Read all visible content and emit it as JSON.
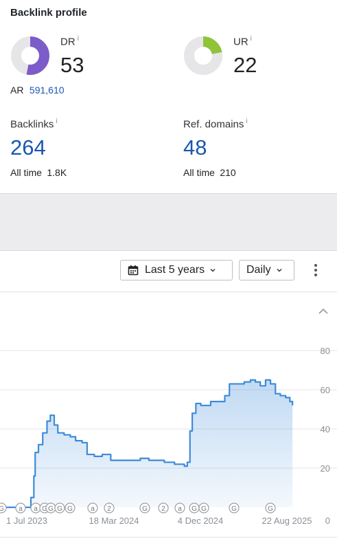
{
  "header": {
    "title": "Backlink profile"
  },
  "dr": {
    "label": "DR",
    "info": "i",
    "value": "53",
    "fraction": 0.53,
    "color": "#7b5cc9"
  },
  "ur": {
    "label": "UR",
    "info": "i",
    "value": "22",
    "fraction": 0.22,
    "color": "#8fc43a"
  },
  "ar": {
    "label": "AR",
    "value": "591,610"
  },
  "backlinks": {
    "label": "Backlinks",
    "info": "i",
    "value": "264",
    "alltime_label": "All time",
    "alltime_value": "1.8K"
  },
  "ref_domains": {
    "label": "Ref. domains",
    "info": "i",
    "value": "48",
    "alltime_label": "All time",
    "alltime_value": "210"
  },
  "toolbar": {
    "period_label": "Last 5 years",
    "interval_label": "Daily",
    "calendar_icon": "calendar-icon",
    "menu_icon": "more-vertical-icon"
  },
  "chart_data": {
    "type": "area",
    "color": "#3d8bd9",
    "x_ticks": [
      "1 Jul 2023",
      "18 Mar 2024",
      "4 Dec 2024",
      "22 Aug 2025"
    ],
    "y_ticks": [
      "80",
      "60",
      "40",
      "20",
      "0"
    ],
    "ylim": [
      0,
      80
    ],
    "grid": true,
    "series": [
      {
        "values": [
          [
            "2023-03-15",
            0
          ],
          [
            "2023-06-20",
            0
          ],
          [
            "2023-06-22",
            5
          ],
          [
            "2023-07-01",
            16
          ],
          [
            "2023-07-05",
            28
          ],
          [
            "2023-07-15",
            32
          ],
          [
            "2023-07-28",
            38
          ],
          [
            "2023-08-10",
            44
          ],
          [
            "2023-08-20",
            47
          ],
          [
            "2023-09-01",
            42
          ],
          [
            "2023-09-12",
            38
          ],
          [
            "2023-10-01",
            37
          ],
          [
            "2023-10-20",
            36
          ],
          [
            "2023-11-05",
            34
          ],
          [
            "2023-11-25",
            33
          ],
          [
            "2023-12-10",
            27
          ],
          [
            "2024-01-01",
            26
          ],
          [
            "2024-01-25",
            27
          ],
          [
            "2024-02-20",
            24
          ],
          [
            "2024-03-20",
            24
          ],
          [
            "2024-04-20",
            24
          ],
          [
            "2024-05-20",
            25
          ],
          [
            "2024-06-15",
            24
          ],
          [
            "2024-07-10",
            24
          ],
          [
            "2024-08-01",
            23
          ],
          [
            "2024-09-01",
            22
          ],
          [
            "2024-10-01",
            21
          ],
          [
            "2024-10-10",
            23
          ],
          [
            "2024-10-18",
            39
          ],
          [
            "2024-10-25",
            48
          ],
          [
            "2024-11-05",
            53
          ],
          [
            "2024-11-20",
            52
          ],
          [
            "2024-12-20",
            54
          ],
          [
            "2025-01-15",
            54
          ],
          [
            "2025-02-01",
            57
          ],
          [
            "2025-02-15",
            63
          ],
          [
            "2025-03-15",
            63
          ],
          [
            "2025-04-01",
            64
          ],
          [
            "2025-04-20",
            65
          ],
          [
            "2025-05-05",
            64
          ],
          [
            "2025-05-20",
            62
          ],
          [
            "2025-06-05",
            65
          ],
          [
            "2025-06-20",
            63
          ],
          [
            "2025-07-05",
            58
          ],
          [
            "2025-07-20",
            57
          ],
          [
            "2025-08-05",
            56
          ],
          [
            "2025-08-18",
            54
          ],
          [
            "2025-08-26",
            52
          ]
        ]
      }
    ],
    "annotations": [
      "G",
      "a",
      "a",
      "G",
      "G",
      "G",
      "G",
      "a",
      "2",
      "G",
      "2",
      "a",
      "G",
      "G",
      "G",
      "G"
    ]
  }
}
